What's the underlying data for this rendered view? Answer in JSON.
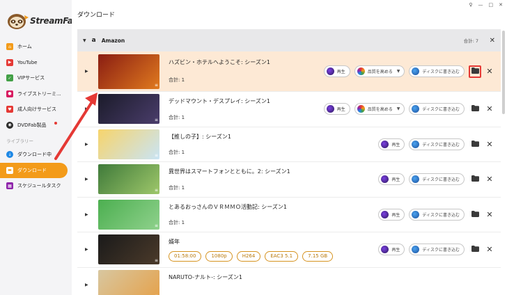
{
  "app": {
    "brand": "StreamFab",
    "window_controls": [
      "♀",
      "—",
      "□",
      "✕"
    ]
  },
  "sidebar": {
    "items": [
      {
        "label": "ホーム",
        "icon": "home-icon",
        "color": "#f39b1a"
      },
      {
        "label": "YouTube",
        "icon": "youtube-icon",
        "color": "#e53935"
      },
      {
        "label": "VIPサービス",
        "icon": "vip-icon",
        "color": "#43a047"
      },
      {
        "label": "ライブストリーミ...",
        "icon": "live-icon",
        "color": "#d81b60"
      },
      {
        "label": "成人向けサービス",
        "icon": "adult-icon",
        "color": "#e53935"
      },
      {
        "label": "DVDFab製品",
        "icon": "dvdfab-icon",
        "color": "#2b2b2b"
      }
    ],
    "library_section": "ライブラリー",
    "library_items": [
      {
        "label": "ダウンロード中",
        "icon": "downloading-icon",
        "color": "#1e88e5"
      },
      {
        "label": "ダウンロード",
        "icon": "downloaded-folder-icon",
        "color": "#f39b1a",
        "active": true
      },
      {
        "label": "スケジュールタスク",
        "icon": "schedule-icon",
        "color": "#8e24aa"
      }
    ]
  },
  "main": {
    "title": "ダウンロード",
    "group": {
      "source": "Amazon",
      "total": "合計: 7"
    },
    "rows": [
      {
        "title": "ハズビン・ホテルへようこそ: シーズン1",
        "count": "合計: 1",
        "play": "再生",
        "quality": "品質を高める",
        "burn": "ディスクに書き込む",
        "highlight": true,
        "thumb_colors": [
          "#8a1d12",
          "#e07a1f"
        ]
      },
      {
        "title": "デッドマウント・デスプレイ: シーズン1",
        "count": "合計: 1",
        "play": "再生",
        "quality": "品質を高める",
        "burn": "ディスクに書き込む",
        "thumb_colors": [
          "#1b1b2a",
          "#4a3d6b"
        ]
      },
      {
        "title": "【推しの子】: シーズン1",
        "count": "合計: 1",
        "play": "再生",
        "burn": "ディスクに書き込む",
        "thumb_colors": [
          "#f7d46b",
          "#c9e4f5"
        ]
      },
      {
        "title": "異世界はスマートフォンとともに。2: シーズン1",
        "count": "合計: 1",
        "play": "再生",
        "burn": "ディスクに書き込む",
        "thumb_colors": [
          "#3f7a3a",
          "#9ec76a"
        ]
      },
      {
        "title": "とあるおっさんのＶＲＭＭＯ活動記: シーズン1",
        "count": "合計: 1",
        "play": "再生",
        "burn": "ディスクに書き込む",
        "thumb_colors": [
          "#4caf50",
          "#8fd18c"
        ]
      },
      {
        "title": "婿年",
        "tags": [
          "01:58:00",
          "1080p",
          "H264",
          "EAC3 5.1",
          "7.15 GB"
        ],
        "play": "再生",
        "burn": "ディスクに書き込む",
        "thumb_colors": [
          "#1a1a1a",
          "#4b3a2a"
        ]
      },
      {
        "title": "NARUTO-ナルト-: シーズン1",
        "play": "",
        "burn": "",
        "thumb_colors": [
          "#d8c7a0",
          "#e5a14a"
        ]
      }
    ]
  },
  "colors": {
    "accent": "#f39b1a",
    "highlight_row": "#fde9d5",
    "annotation_red": "#e53935"
  }
}
